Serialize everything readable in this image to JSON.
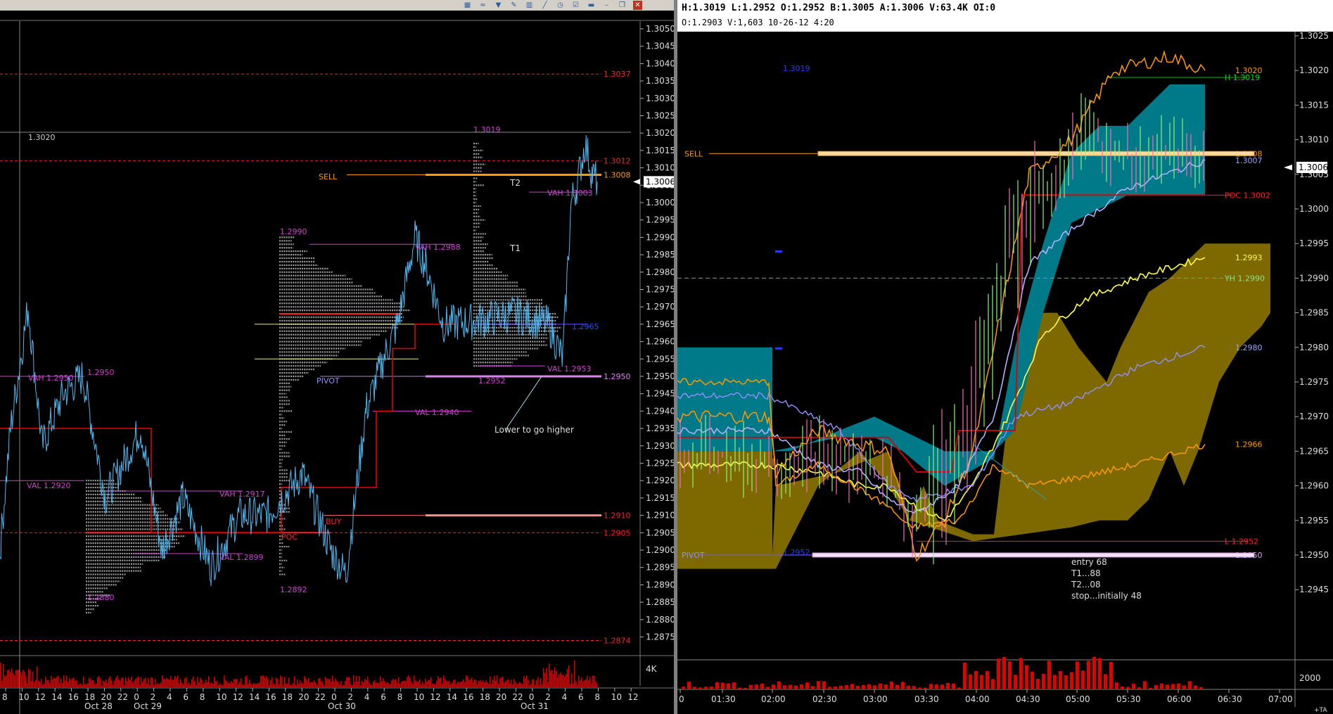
{
  "left_toolbar_icons": [
    "bar-chart-icon",
    "wave-icon",
    "filter-icon",
    "pencil-icon",
    "bars-icon",
    "line-icon",
    "clock-icon",
    "checklist-icon",
    "trash-icon",
    "minimize-icon",
    "restore-icon",
    "close-icon"
  ],
  "right_header": {
    "line1": "H:1.3019  L:1.2952  O:1.2952  B:1.3005  A:1.3006  V:63.4K  OI:0",
    "line2": "O:1.2903  V:1,603  10-26-12  4:20"
  },
  "colors": {
    "price_line": "#4fb8f0",
    "level_red": "#ff2020",
    "magenta": "#d040d0",
    "orange": "#ff9900",
    "teal": "#008a9a",
    "olive": "#8a7000",
    "volume": "#e00000"
  },
  "left_chart": {
    "y_ticks": [
      "1.3050",
      "1.3045",
      "1.3040",
      "1.3035",
      "1.3030",
      "1.3025",
      "1.3020",
      "1.3015",
      "1.3010",
      "1.3005",
      "1.3000",
      "1.2995",
      "1.2990",
      "1.2985",
      "1.2980",
      "1.2975",
      "1.2970",
      "1.2965",
      "1.2960",
      "1.2955",
      "1.2950",
      "1.2945",
      "1.2940",
      "1.2935",
      "1.2930",
      "1.2925",
      "1.2920",
      "1.2915",
      "1.2910",
      "1.2905",
      "1.2900",
      "1.2895",
      "1.2890",
      "1.2885",
      "1.2880",
      "1.2875"
    ],
    "current_price": "1.3006",
    "x_ticks": [
      "8",
      "10",
      "12",
      "14",
      "16",
      "18",
      "20",
      "22",
      "0",
      "2",
      "4",
      "6",
      "8",
      "10",
      "12",
      "14",
      "16",
      "18",
      "20",
      "22",
      "0",
      "2",
      "4",
      "6",
      "8",
      "10",
      "12",
      "14",
      "16",
      "18",
      "20",
      "22",
      "0",
      "2",
      "4",
      "6",
      "8",
      "10",
      "12"
    ],
    "date_labels": [
      "Oct 28",
      "Oct 29",
      "Oct 30",
      "Oct 31"
    ],
    "volume_label": "4K",
    "crosshair_label": "1.3020",
    "levels": [
      {
        "label": "1.3037",
        "price": 1.3037
      },
      {
        "label": "1.3012",
        "price": 1.3012
      },
      {
        "label": "1.3008",
        "price": 1.3008
      },
      {
        "label": "1.2950",
        "price": 1.295
      },
      {
        "label": "1.2910",
        "price": 1.291
      },
      {
        "label": "1.2905",
        "price": 1.2905
      },
      {
        "label": "1.2874",
        "price": 1.2874
      }
    ],
    "annotations": {
      "sell": "SELL",
      "buy": "BUY",
      "pivot": "PIVOT",
      "poc": "POC",
      "t1": "T1",
      "t2": "T2",
      "lower_to_go_higher": "Lower to go higher",
      "vah_2950": "VAH 1.2950",
      "val_2920": "VAL 1.2920",
      "p_2950": "1.2950",
      "p_2880": "1.2880",
      "vah_2917": "VAH 1.2917",
      "val_2899": "VAL 1.2899",
      "p_2990": "1.2990",
      "p_2892": "1.2892",
      "vah_2988": "VAH 1.2988",
      "val_2940": "VAL 1.2940",
      "p_3019": "1.3019",
      "vah_3003": "VAH 1.3003",
      "val_2953": "VAL 1.2953",
      "p_2952": "1.2952",
      "p_2965": "1.2965"
    }
  },
  "right_chart": {
    "y_ticks": [
      "1.3025",
      "1.3020",
      "1.3015",
      "1.3010",
      "1.3005",
      "1.3000",
      "1.2995",
      "1.2990",
      "1.2985",
      "1.2980",
      "1.2975",
      "1.2970",
      "1.2965",
      "1.2960",
      "1.2955",
      "1.2950",
      "1.2945"
    ],
    "current_price": "1.3006",
    "x_ticks": [
      "0",
      "01:30",
      "02:00",
      "02:30",
      "03:00",
      "03:30",
      "04:00",
      "04:30",
      "05:00",
      "05:30",
      "06:00",
      "06:30",
      "07:00"
    ],
    "volume_label": "2000",
    "levels": [
      {
        "label": "1.3020",
        "price": 1.302
      },
      {
        "label": "H 1.3019",
        "price": 1.3019
      },
      {
        "label": "1.3008",
        "price": 1.3008
      },
      {
        "label": "1.3007",
        "price": 1.3007
      },
      {
        "label": "POC 1.3002",
        "price": 1.3002
      },
      {
        "label": "1.2993",
        "price": 1.2993
      },
      {
        "label": "YH 1.2990",
        "price": 1.299
      },
      {
        "label": "1.2980",
        "price": 1.298
      },
      {
        "label": "1.2966",
        "price": 1.2966
      },
      {
        "label": "L 1.2952",
        "price": 1.2952
      },
      {
        "label": "1.2950",
        "price": 1.295
      }
    ],
    "annotations": {
      "sell": "SELL",
      "pivot": "PIVOT",
      "p_3019_blue": "1.3019",
      "p_2952_blue": "1.2952",
      "entry": "entry 68",
      "t1": "T1...88",
      "t2": "T2...08",
      "stop": "stop...initially 48"
    },
    "footer_ta": "+TA"
  }
}
